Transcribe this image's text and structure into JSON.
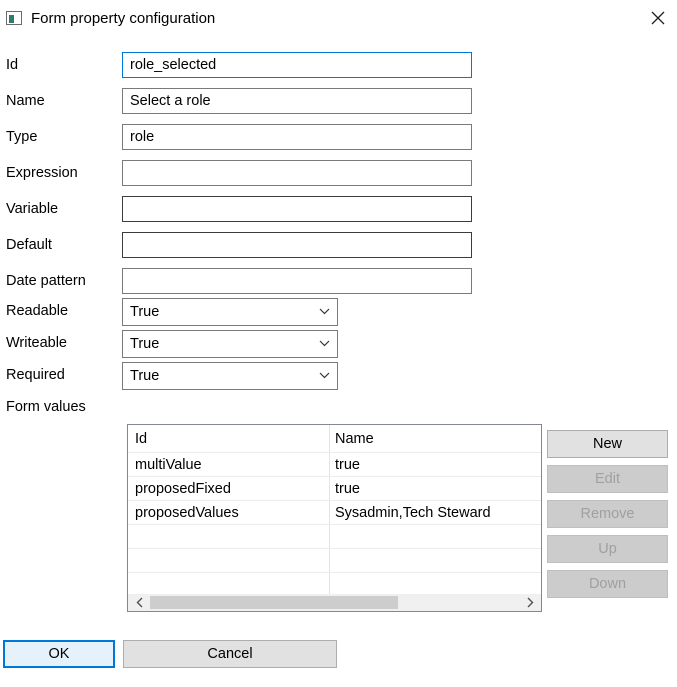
{
  "window": {
    "title": "Form property configuration"
  },
  "fields": {
    "id": {
      "label": "Id",
      "value": "role_selected"
    },
    "name": {
      "label": "Name",
      "value": "Select a role"
    },
    "type": {
      "label": "Type",
      "value": "role"
    },
    "expression": {
      "label": "Expression",
      "value": ""
    },
    "variable": {
      "label": "Variable",
      "value": ""
    },
    "default": {
      "label": "Default",
      "value": ""
    },
    "date_pattern": {
      "label": "Date pattern",
      "value": ""
    }
  },
  "selects": {
    "readable": {
      "label": "Readable",
      "value": "True"
    },
    "writeable": {
      "label": "Writeable",
      "value": "True"
    },
    "required": {
      "label": "Required",
      "value": "True"
    }
  },
  "form_values": {
    "label": "Form values",
    "columns": [
      "Id",
      "Name"
    ],
    "rows": [
      [
        "multiValue",
        "true"
      ],
      [
        "proposedFixed",
        "true"
      ],
      [
        "proposedValues",
        "Sysadmin,Tech Steward"
      ]
    ]
  },
  "side_buttons": {
    "new": "New",
    "edit": "Edit",
    "remove": "Remove",
    "up": "Up",
    "down": "Down"
  },
  "buttons": {
    "ok": "OK",
    "cancel": "Cancel"
  },
  "icons": {
    "app": "window-app-icon",
    "close": "close-icon",
    "dropdown": "chevron-down-icon",
    "scroll_left": "chevron-left-icon",
    "scroll_right": "chevron-right-icon"
  },
  "colors": {
    "focus": "#0078d7",
    "disabled_text": "#a0a0a0"
  }
}
